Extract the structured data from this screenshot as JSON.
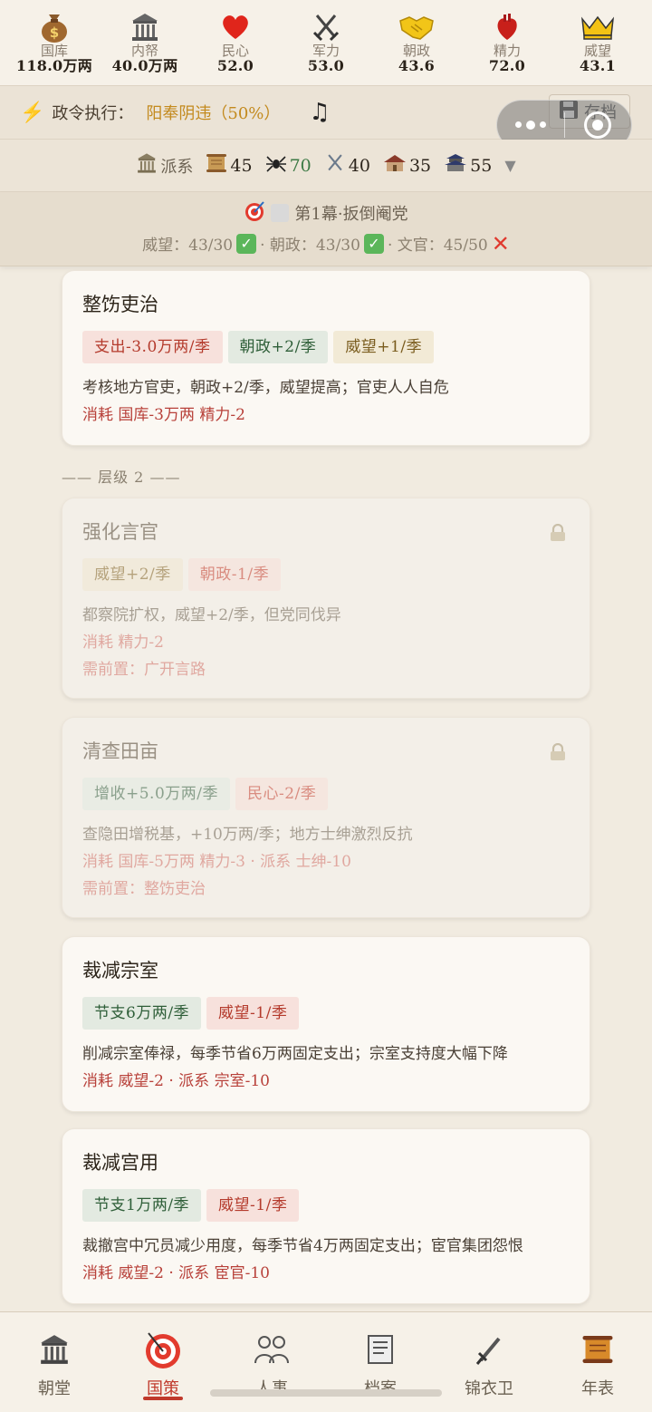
{
  "stats": [
    {
      "label": "国库",
      "value": "118.0万两",
      "icon": "money-bag-icon"
    },
    {
      "label": "内帑",
      "value": "40.0万两",
      "icon": "temple-icon"
    },
    {
      "label": "民心",
      "value": "52.0",
      "icon": "heart-icon"
    },
    {
      "label": "军力",
      "value": "53.0",
      "icon": "crossed-swords-icon"
    },
    {
      "label": "朝政",
      "value": "43.6",
      "icon": "handshake-icon"
    },
    {
      "label": "精力",
      "value": "72.0",
      "icon": "anatomical-heart-icon"
    },
    {
      "label": "威望",
      "value": "43.1",
      "icon": "crown-icon"
    }
  ],
  "decree": {
    "label": "政令执行：",
    "state": "阳奉阴违（50%）",
    "save": "存档"
  },
  "faction": {
    "label": "派系",
    "items": [
      {
        "icon": "scroll-icon",
        "value": "45"
      },
      {
        "icon": "spider-icon",
        "value": "70"
      },
      {
        "icon": "swords-icon",
        "value": "40"
      },
      {
        "icon": "house-icon",
        "value": "35"
      },
      {
        "icon": "palace-icon",
        "value": "55"
      }
    ]
  },
  "goal": {
    "title": "第1幕·扳倒阉党",
    "cond1": "威望：43/30",
    "cond2": "· 朝政：43/30",
    "cond3": "· 文官：45/50",
    "ok_mark": "✓",
    "fail_mark": "✕"
  },
  "tier_label": "—— 层级 2 ——",
  "cards": [
    {
      "title": "整饬吏治",
      "tags": [
        "支出-3.0万两/季",
        "朝政+2/季",
        "威望+1/季"
      ],
      "desc": "考核地方官吏，朝政+2/季，威望提高；官吏人人自危",
      "cost": "消耗 国库-3万两 精力-2"
    },
    {
      "title": "强化言官",
      "tags": [
        "威望+2/季",
        "朝政-1/季"
      ],
      "desc": "都察院扩权，威望+2/季，但党同伐异",
      "cost": "消耗 精力-2",
      "req": "需前置：广开言路"
    },
    {
      "title": "清查田亩",
      "tags": [
        "增收+5.0万两/季",
        "民心-2/季"
      ],
      "desc": "查隐田增税基，+10万两/季；地方士绅激烈反抗",
      "cost": "消耗 国库-5万两 精力-3 · 派系 士绅-10",
      "req": "需前置：整饬吏治"
    },
    {
      "title": "裁减宗室",
      "tags": [
        "节支6万两/季",
        "威望-1/季"
      ],
      "desc": "削减宗室俸禄，每季节省6万两固定支出；宗室支持度大幅下降",
      "cost": "消耗 威望-2 · 派系 宗室-10"
    },
    {
      "title": "裁减宫用",
      "tags": [
        "节支1万两/季",
        "威望-1/季"
      ],
      "desc": "裁撤宫中冗员减少用度，每季节省4万两固定支出；宦官集团怨恨",
      "cost": "消耗 威望-2 · 派系 宦官-10"
    }
  ],
  "nav": [
    {
      "label": "朝堂",
      "icon": "court-icon"
    },
    {
      "label": "国策",
      "icon": "target-icon"
    },
    {
      "label": "人事",
      "icon": "people-icon"
    },
    {
      "label": "档案",
      "icon": "document-icon"
    },
    {
      "label": "锦衣卫",
      "icon": "dagger-icon"
    },
    {
      "label": "年表",
      "icon": "scroll-icon"
    }
  ],
  "colors": {
    "accent": "#c0392b",
    "cost_red": "#b8413a",
    "warning_gold": "#c38a1e"
  }
}
